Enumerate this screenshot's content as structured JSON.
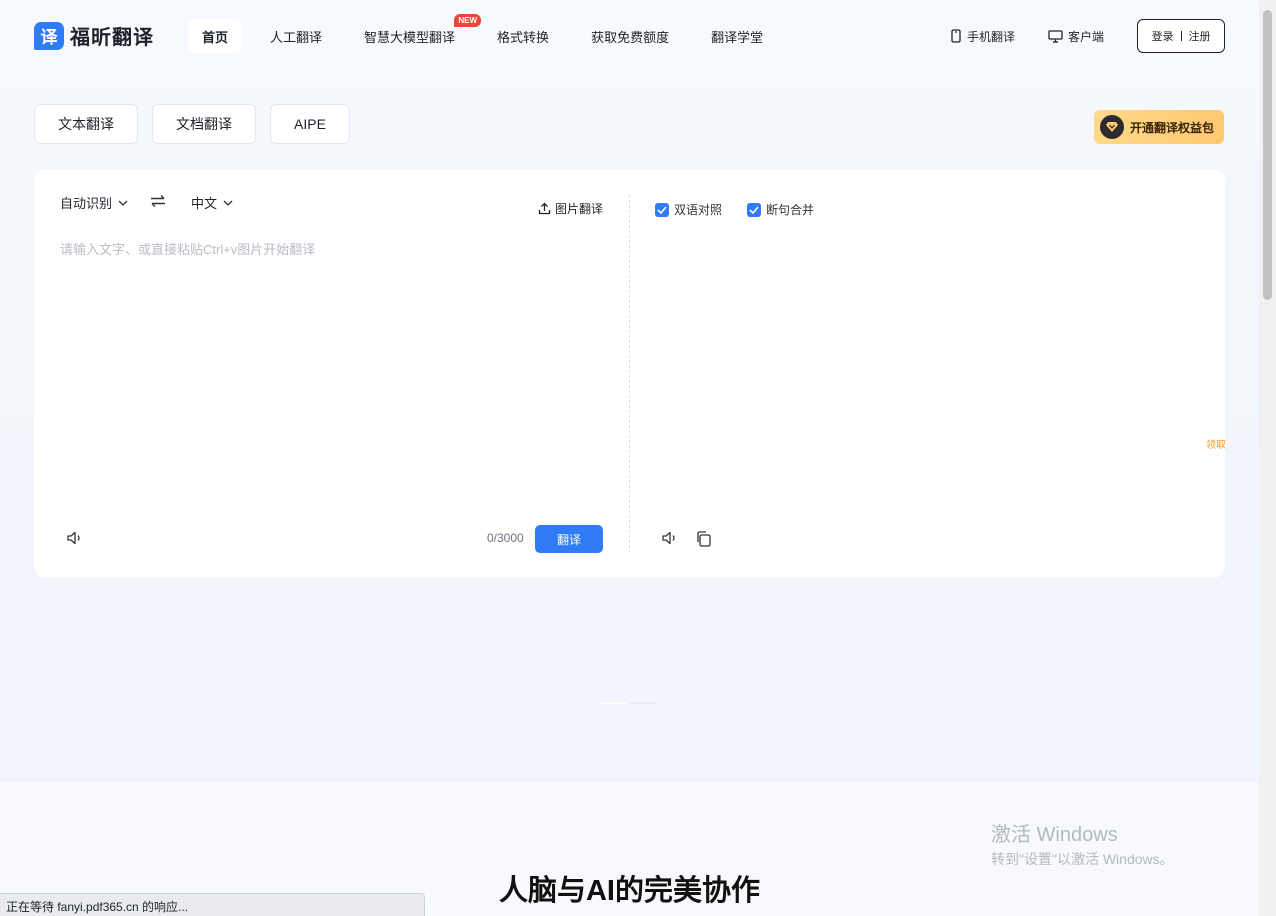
{
  "brand": {
    "logo_mark": "译",
    "name": "福昕翻译"
  },
  "nav": {
    "items": [
      {
        "label": "首页",
        "active": true
      },
      {
        "label": "人工翻译"
      },
      {
        "label": "智慧大模型翻译",
        "badge": "NEW"
      },
      {
        "label": "格式转换"
      },
      {
        "label": "获取免费额度"
      },
      {
        "label": "翻译学堂"
      }
    ]
  },
  "header_right": {
    "mobile": "手机翻译",
    "client": "客户端",
    "login": "登录",
    "register": "注册"
  },
  "mode_tabs": [
    "文本翻译",
    "文档翻译",
    "AIPE"
  ],
  "vip_button": "开通翻译权益包",
  "translator": {
    "source_lang": "自动识别",
    "target_lang": "中文",
    "image_translate": "图片翻译",
    "placeholder": "请输入文字、或直接粘贴Ctrl+v图片开始翻译",
    "char_count": "0/3000",
    "translate_button": "翻译",
    "options": {
      "bilingual": "双语对照",
      "merge_sentences": "断句合并"
    }
  },
  "side_tab": "领取",
  "headline": "人脑与AI的完美协作",
  "watermark": {
    "title": "激活 Windows",
    "subtitle": "转到\"设置\"以激活 Windows。"
  },
  "status_bar": "正在等待 fanyi.pdf365.cn 的响应...",
  "colors": {
    "accent": "#2f7cf6",
    "new_badge": "#f0453a",
    "vip": "#ffc870"
  }
}
